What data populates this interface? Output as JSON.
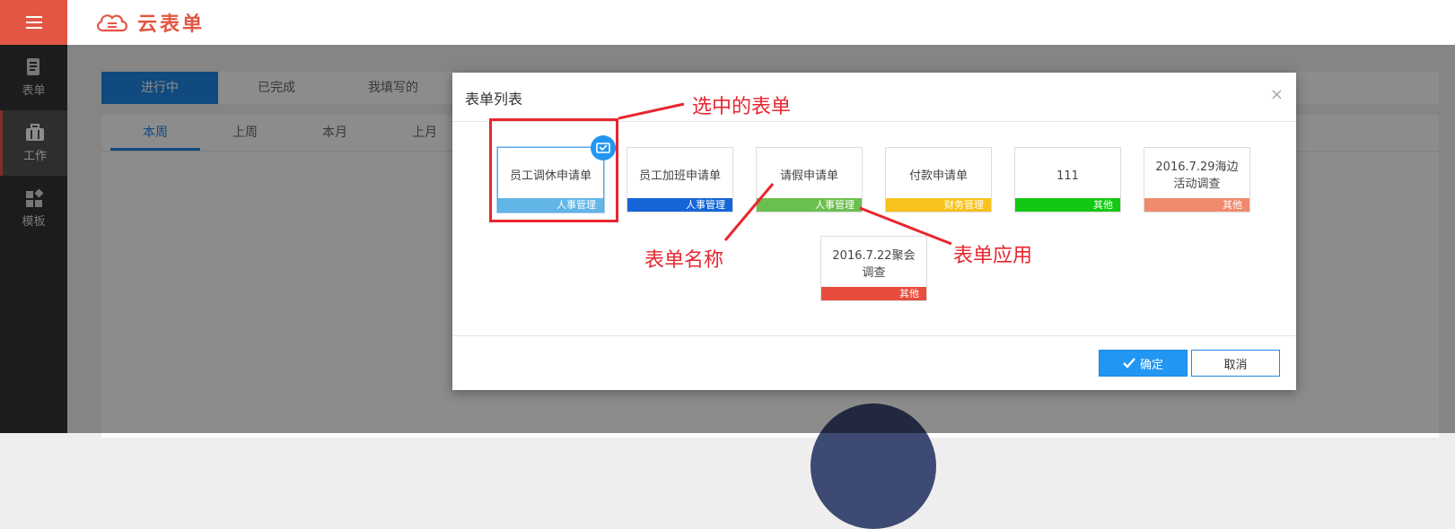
{
  "header": {
    "logo_text": "云表单",
    "accent_color": "#e25643",
    "menu_icon": "hamburger-menu-icon"
  },
  "sidebar": {
    "items": [
      {
        "label": "表单",
        "icon": "document-icon",
        "active": false
      },
      {
        "label": "工作",
        "icon": "briefcase-icon",
        "active": true
      },
      {
        "label": "模板",
        "icon": "template-grid-icon",
        "active": false
      }
    ]
  },
  "main": {
    "tabs": [
      "进行中",
      "已完成",
      "我填写的"
    ],
    "active_tab": "进行中",
    "period_tabs": [
      "本周",
      "上周",
      "本月",
      "上月"
    ],
    "active_period": "本周"
  },
  "modal": {
    "title": "表单列表",
    "close_symbol": "×",
    "ok_label": "确定",
    "cancel_label": "取消",
    "forms": [
      {
        "name": "员工调休申请单",
        "tag": "人事管理",
        "tag_color": "#62b6e7",
        "selected": true
      },
      {
        "name": "员工加班申请单",
        "tag": "人事管理",
        "tag_color": "#1565d8",
        "selected": false
      },
      {
        "name": "请假申请单",
        "tag": "人事管理",
        "tag_color": "#6bbf4e",
        "selected": false
      },
      {
        "name": "付款申请单",
        "tag": "财务管理",
        "tag_color": "#f7c21b",
        "selected": false
      },
      {
        "name": "111",
        "tag": "其他",
        "tag_color": "#13c813",
        "selected": false
      },
      {
        "name": "2016.7.29海边活动调查",
        "tag": "其他",
        "tag_color": "#f08a6c",
        "selected": false
      },
      {
        "name": "2016.7.22聚会调查",
        "tag": "其他",
        "tag_color": "#e74c3c",
        "selected": false
      }
    ]
  },
  "annotations": {
    "selected_form": "选中的表单",
    "form_name": "表单名称",
    "form_app": "表单应用",
    "color": "#e8262f"
  }
}
